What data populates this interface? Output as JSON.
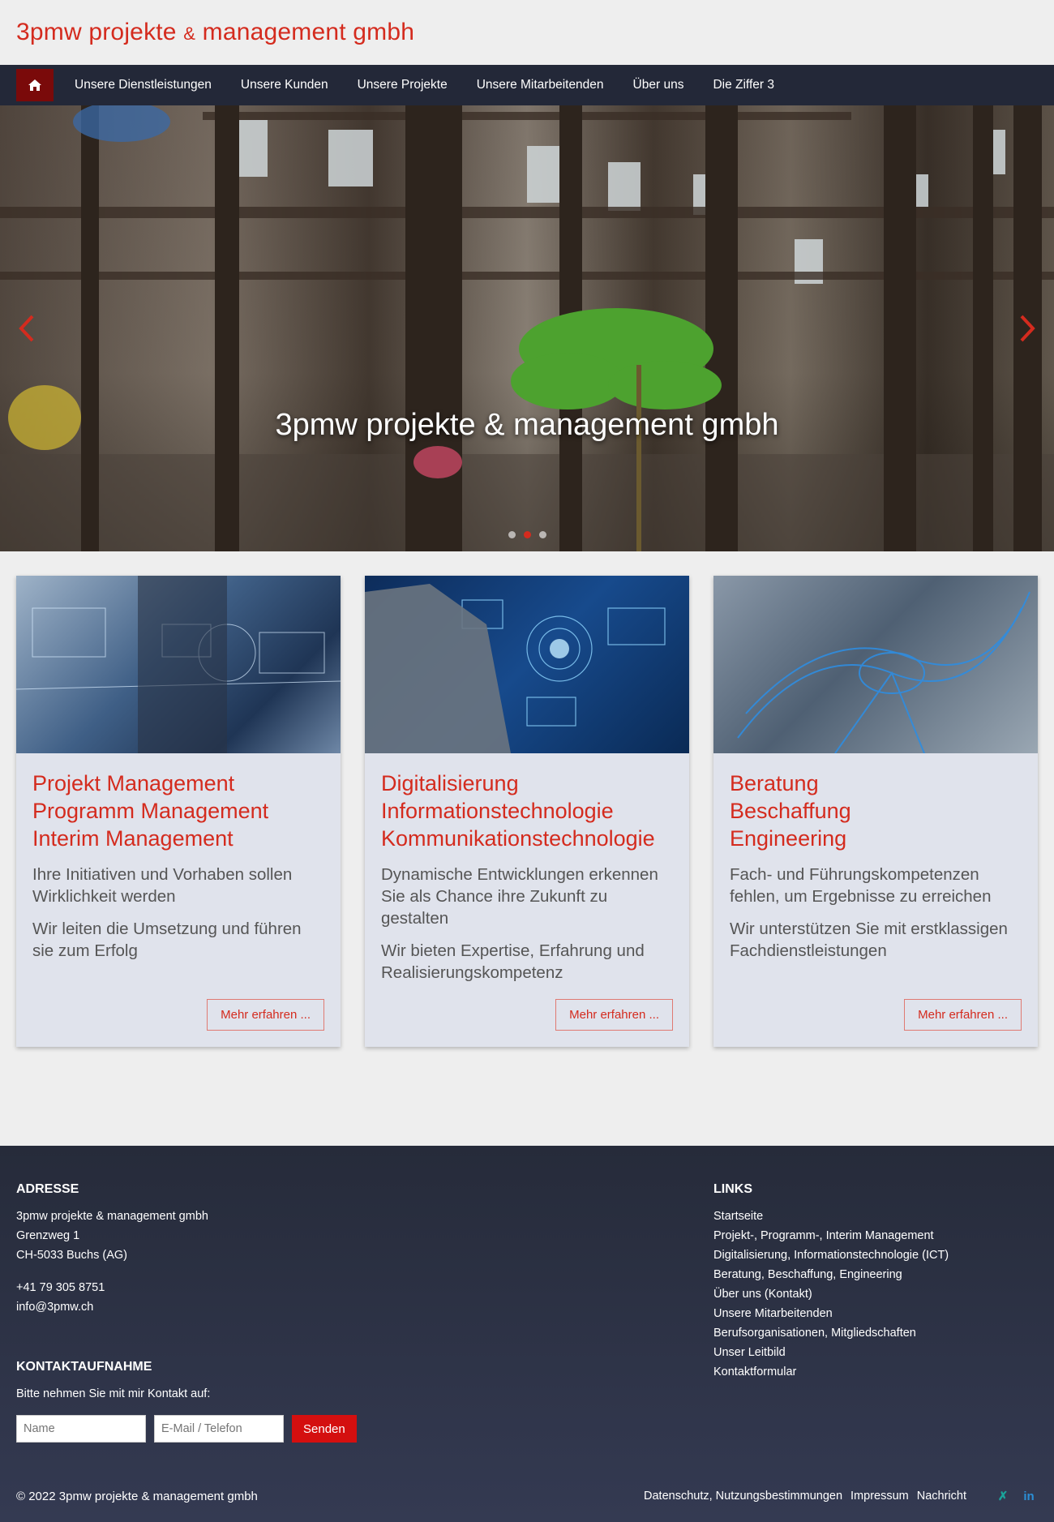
{
  "header": {
    "brand_part1": "3pmw projekte ",
    "brand_amp": "&",
    "brand_part2": " management gmbh"
  },
  "nav": {
    "home_icon": "home-icon",
    "items": [
      "Unsere Dienstleistungen",
      "Unsere Kunden",
      "Unsere Projekte",
      "Unsere Mitarbeitenden",
      "Über uns",
      "Die Ziffer 3"
    ]
  },
  "hero": {
    "title": "3pmw projekte & management gmbh",
    "slide_count": 3,
    "active_slide": 2
  },
  "cards": [
    {
      "title_lines": [
        "Projekt Management",
        "Programm Management",
        "Interim Management"
      ],
      "paragraphs": [
        "Ihre Initiativen und Vorhaben sollen Wirklichkeit werden",
        "Wir leiten die Umsetzung und führen sie zum Erfolg"
      ],
      "button": "Mehr erfahren ..."
    },
    {
      "title_lines": [
        "Digitalisierung",
        "Informationstechnologie",
        "Kommunikationstechnologie"
      ],
      "paragraphs": [
        "Dynamische Entwicklungen erkennen Sie als Chance ihre Zukunft zu gestalten",
        "Wir bieten Expertise, Erfahrung und Realisierungskompetenz"
      ],
      "button": "Mehr erfahren ..."
    },
    {
      "title_lines": [
        "Beratung",
        "Beschaffung",
        "Engineering"
      ],
      "paragraphs": [
        "Fach- und Führungskompetenzen fehlen, um Ergebnisse zu erreichen",
        "Wir unterstützen Sie mit erstklassigen Fachdienstleistungen"
      ],
      "button": "Mehr erfahren ..."
    }
  ],
  "footer": {
    "address": {
      "heading": "ADRESSE",
      "company": "3pmw projekte & management gmbh",
      "street": "Grenzweg 1",
      "city": "CH-5033 Buchs (AG)",
      "phone": "+41 79 305 8751",
      "email": "info@3pmw.ch"
    },
    "links": {
      "heading": "LINKS",
      "items": [
        "Startseite",
        "Projekt-, Programm-, Interim Management",
        "Digitalisierung, Informationstechnologie (ICT)",
        "Beratung, Beschaffung, Engineering",
        "Über uns (Kontakt)",
        "Unsere Mitarbeitenden",
        "Berufsorganisationen, Mitgliedschaften",
        "Unser Leitbild",
        "Kontaktformular"
      ]
    },
    "contact": {
      "heading": "KONTAKTAUFNAHME",
      "prompt": "Bitte nehmen Sie mit mir Kontakt auf:",
      "name_placeholder": "Name",
      "email_placeholder": "E-Mail / Telefon",
      "send": "Senden"
    },
    "bottom": {
      "copyright": "© 2022   3pmw projekte & management gmbh",
      "links": [
        "Datenschutz, Nutzungsbestimmungen",
        "Impressum",
        "Nachricht"
      ],
      "social": [
        {
          "icon": "xing-icon",
          "glyph": "✗",
          "color": "#1aa39a"
        },
        {
          "icon": "linkedin-icon",
          "glyph": "in",
          "color": "#2b8fd6"
        }
      ]
    }
  },
  "colors": {
    "brand_red": "#d42b1e",
    "nav_bg": "#232838",
    "home_bg": "#7a0a0a",
    "card_bg": "#e0e3ec"
  }
}
